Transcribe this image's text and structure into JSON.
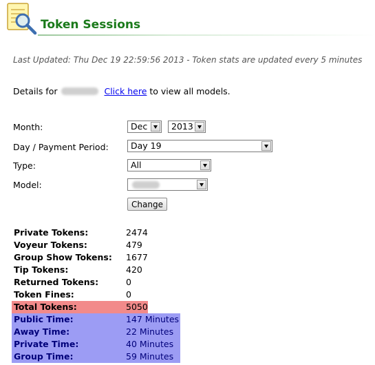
{
  "header": {
    "title": "Token Sessions",
    "logo_icon": "notepad-magnifier-icon"
  },
  "updated_text": "Last Updated: Thu Dec 19 22:59:56 2013 - Token stats are updated every 5 minutes",
  "details": {
    "prefix": "Details for",
    "link_text": "Click here",
    "suffix": "to view all models."
  },
  "form": {
    "month_label": "Month:",
    "month_value": "Dec",
    "year_value": "2013",
    "day_label": "Day / Payment Period:",
    "day_value": "Day 19",
    "type_label": "Type:",
    "type_value": "All",
    "model_label": "Model:",
    "model_value": "",
    "change_button": "Change"
  },
  "stats": [
    {
      "label": "Private Tokens:",
      "value": "2474"
    },
    {
      "label": "Voyeur Tokens:",
      "value": "479"
    },
    {
      "label": "Group Show Tokens:",
      "value": "1677"
    },
    {
      "label": "Tip Tokens:",
      "value": "420"
    },
    {
      "label": "Returned Tokens:",
      "value": "0"
    },
    {
      "label": "Token Fines:",
      "value": "0"
    },
    {
      "label": "Total Tokens:",
      "value": "5050"
    },
    {
      "label": "Public Time:",
      "value": "147 Minutes"
    },
    {
      "label": "Away Time:",
      "value": "22 Minutes"
    },
    {
      "label": "Private Time:",
      "value": "40 Minutes"
    },
    {
      "label": "Group Time:",
      "value": "59 Minutes"
    }
  ],
  "colors": {
    "title": "#1a7a1a",
    "total_highlight": "#f28a8a",
    "time_highlight": "#9c9cf4"
  }
}
